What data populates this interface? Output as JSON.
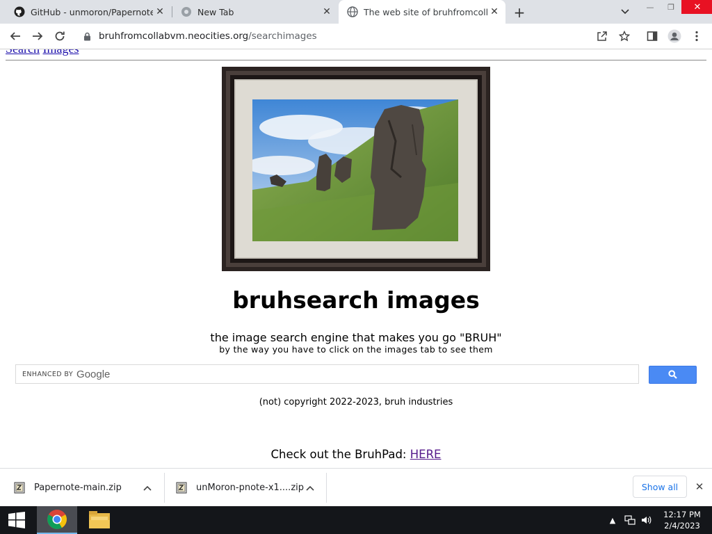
{
  "browser": {
    "tabs": [
      {
        "title": "GitHub - unmoron/Papernote: Pa",
        "favicon": "github-icon",
        "active": false
      },
      {
        "title": "New Tab",
        "favicon": "chrome-newtab-icon",
        "active": false
      },
      {
        "title": "The web site of bruhfromcollabv",
        "favicon": "globe-icon",
        "active": true
      }
    ],
    "url_host": "bruhfromcollabvm.neocities.org",
    "url_path": "/searchimages"
  },
  "page": {
    "top_links": [
      "Search",
      "Images"
    ],
    "heading": "bruhsearch images",
    "tagline": "the image search engine that makes you go \"BRUH\"",
    "subtagline": "by the way you have to click on the images tab to see them",
    "search": {
      "enhanced_by": "ENHANCED BY",
      "google": "Google",
      "button_icon": "search-icon"
    },
    "copyright": "(not) copyright 2022-2023, bruh industries",
    "bruhpad_text": "Check out the BruhPad: ",
    "bruhpad_link": "HERE"
  },
  "downloads": {
    "items": [
      {
        "name": "Papernote-main.zip",
        "icon": "zip-file-icon"
      },
      {
        "name": "unMoron-pnote-x1....zip",
        "icon": "zip-file-icon"
      }
    ],
    "show_all": "Show all"
  },
  "taskbar": {
    "time": "12:17 PM",
    "date": "2/4/2023"
  },
  "colors": {
    "accent": "#4a8af4",
    "link_visited": "#551a8b",
    "close_red": "#e81123"
  }
}
